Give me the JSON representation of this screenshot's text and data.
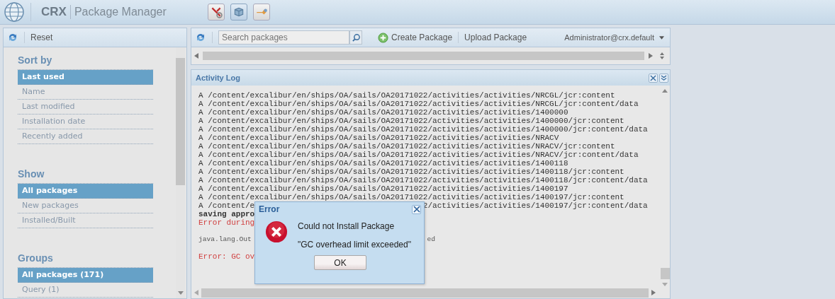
{
  "header": {
    "brand": "CRX",
    "title": "Package Manager",
    "tools": [
      {
        "kind": "tools",
        "selected": false
      },
      {
        "kind": "package",
        "selected": true
      },
      {
        "kind": "share",
        "selected": false
      }
    ]
  },
  "sidebar": {
    "reset": "Reset",
    "sections": [
      {
        "title": "Sort by",
        "items": [
          {
            "label": "Last used",
            "selected": true
          },
          {
            "label": "Name",
            "selected": false
          },
          {
            "label": "Last modified",
            "selected": false
          },
          {
            "label": "Installation date",
            "selected": false
          },
          {
            "label": "Recently added",
            "selected": false
          }
        ]
      },
      {
        "title": "Show",
        "items": [
          {
            "label": "All packages",
            "selected": true
          },
          {
            "label": "New packages",
            "selected": false
          },
          {
            "label": "Installed/Built",
            "selected": false
          }
        ]
      },
      {
        "title": "Groups",
        "items": [
          {
            "label": "All packages (171)",
            "selected": true
          },
          {
            "label": "Query (1)",
            "selected": false
          }
        ]
      }
    ]
  },
  "toolbar": {
    "search": {
      "placeholder": "Search packages"
    },
    "create": "Create Package",
    "upload": "Upload Package",
    "user": "Administrator@crx.default"
  },
  "activity_log": {
    "title": "Activity Log",
    "lines": [
      {
        "kind": "normal",
        "text": "A /content/excalibur/en/ships/OA/sails/OA20171022/activities/activities/NRCGL/jcr:content"
      },
      {
        "kind": "normal",
        "text": "A /content/excalibur/en/ships/OA/sails/OA20171022/activities/activities/NRCGL/jcr:content/data"
      },
      {
        "kind": "normal",
        "text": "A /content/excalibur/en/ships/OA/sails/OA20171022/activities/activities/1400000"
      },
      {
        "kind": "normal",
        "text": "A /content/excalibur/en/ships/OA/sails/OA20171022/activities/activities/1400000/jcr:content"
      },
      {
        "kind": "normal",
        "text": "A /content/excalibur/en/ships/OA/sails/OA20171022/activities/activities/1400000/jcr:content/data"
      },
      {
        "kind": "normal",
        "text": "A /content/excalibur/en/ships/OA/sails/OA20171022/activities/activities/NRACV"
      },
      {
        "kind": "normal",
        "text": "A /content/excalibur/en/ships/OA/sails/OA20171022/activities/activities/NRACV/jcr:content"
      },
      {
        "kind": "normal",
        "text": "A /content/excalibur/en/ships/OA/sails/OA20171022/activities/activities/NRACV/jcr:content/data"
      },
      {
        "kind": "normal",
        "text": "A /content/excalibur/en/ships/OA/sails/OA20171022/activities/activities/1400118"
      },
      {
        "kind": "normal",
        "text": "A /content/excalibur/en/ships/OA/sails/OA20171022/activities/activities/1400118/jcr:content"
      },
      {
        "kind": "normal",
        "text": "A /content/excalibur/en/ships/OA/sails/OA20171022/activities/activities/1400118/jcr:content/data"
      },
      {
        "kind": "normal",
        "text": "A /content/excalibur/en/ships/OA/sails/OA20171022/activities/activities/1400197"
      },
      {
        "kind": "normal",
        "text": "A /content/excalibur/en/ships/OA/sails/OA20171022/activities/activities/1400197/jcr:content"
      },
      {
        "kind": "normal",
        "text": "A /content/e",
        "tail": "2/activities/activities/1400197/jcr:content/data"
      },
      {
        "kind": "bold",
        "text": "saving appro"
      },
      {
        "kind": "error",
        "text": "Error during"
      },
      {
        "kind": "blank"
      },
      {
        "kind": "light",
        "text": "java.lang.Out",
        "tail": "ed"
      },
      {
        "kind": "blank"
      },
      {
        "kind": "error",
        "text": "Error: GC ov"
      }
    ]
  },
  "dialog": {
    "title": "Error",
    "message": "Could not Install Package",
    "detail": "\"GC overhead limit exceeded\"",
    "button": "OK"
  }
}
